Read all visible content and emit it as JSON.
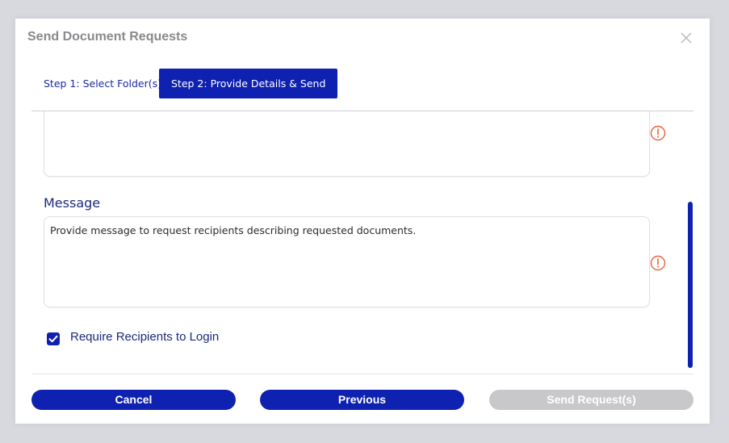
{
  "dialog": {
    "title": "Send Document Requests",
    "close_icon": "close-icon"
  },
  "tabs": [
    {
      "label": "Step 1: Select Folder(s)",
      "active": false
    },
    {
      "label": "Step 2: Provide Details & Send",
      "active": true
    }
  ],
  "form": {
    "message_label": "Message",
    "message_placeholder": "Provide message to request recipients describing requested documents.",
    "warning_icon": "alert-circle-icon",
    "require_login": {
      "label": "Require Recipients to Login",
      "checked": true
    }
  },
  "buttons": {
    "cancel": "Cancel",
    "previous": "Previous",
    "send": "Send Request(s)",
    "send_disabled": true
  },
  "colors": {
    "primary": "#0f21b0",
    "label_text": "#1b2a7a",
    "warning": "#e8643c",
    "disabled": "#c8c8cb"
  }
}
